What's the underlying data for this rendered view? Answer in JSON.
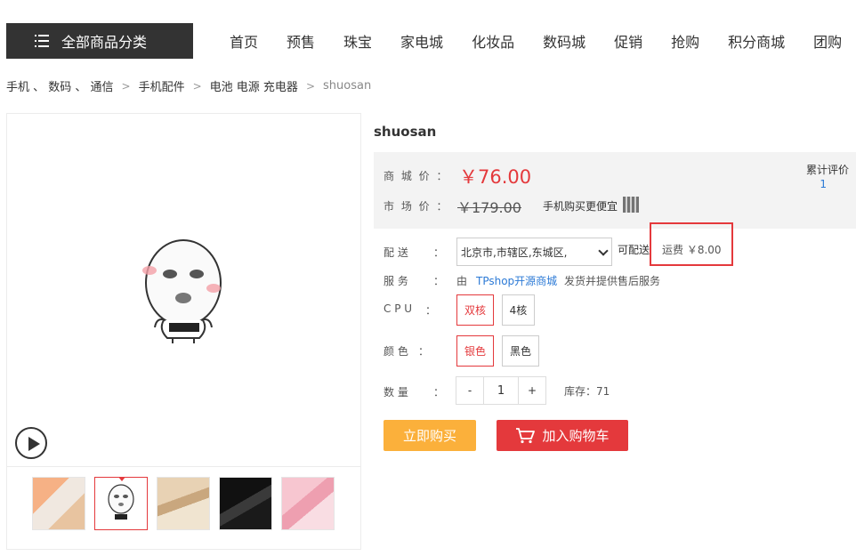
{
  "nav": {
    "category_button": "全部商品分类",
    "items": [
      "首页",
      "预售",
      "珠宝",
      "家电城",
      "化妆品",
      "数码城",
      "促销",
      "抢购",
      "积分商城",
      "团购"
    ]
  },
  "breadcrumb": {
    "level1": "手机 、 数码 、 通信",
    "level2": "手机配件",
    "level3": "电池 电源 充电器",
    "current": "shuosan"
  },
  "product": {
    "title": "shuosan",
    "shop_price_label": "商 城 价 ：",
    "shop_price": "￥76.00",
    "market_price_label": "市 场 价 ：",
    "market_price": "￥179.00",
    "mobile_cheaper": "手机购买更便宜",
    "review_label": "累计评价",
    "review_count": "1"
  },
  "delivery": {
    "label": "配    送",
    "address": "北京市,市辖区,东城区,",
    "available": "可配送",
    "freight": "运费 ￥8.00"
  },
  "service": {
    "label": "服    务",
    "by": "由",
    "shop_link": "TPshop开源商城",
    "rest": "发货并提供售后服务"
  },
  "specs": {
    "cpu_label": "C P U",
    "cpu_options": [
      "双核",
      "4核"
    ],
    "color_label": "颜 色",
    "color_options": [
      "银色",
      "黑色"
    ]
  },
  "quantity": {
    "label": "数    量",
    "minus": "-",
    "value": "1",
    "plus": "+",
    "stock": "库存：71"
  },
  "actions": {
    "buy_now": "立即购买",
    "add_to_cart": "加入购物车"
  },
  "colors": {
    "accent_red": "#e4393c",
    "buy_orange": "#fbb03b",
    "link_blue": "#2c7ad6"
  }
}
